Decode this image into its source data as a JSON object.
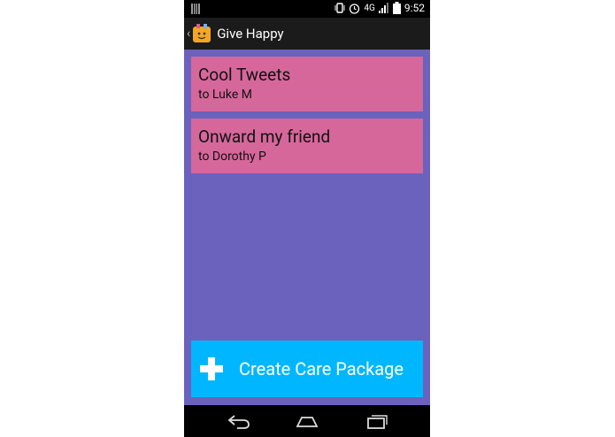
{
  "status_bar": {
    "network": "4G",
    "battery": "",
    "time": "9:52"
  },
  "action_bar": {
    "title": "Give Happy",
    "back_icon": "chevron-left-icon",
    "logo_icon": "smiley-box-icon"
  },
  "cards": [
    {
      "title": "Cool Tweets",
      "subtitle": "to Luke M"
    },
    {
      "title": "Onward my friend",
      "subtitle": "to Dorothy P"
    }
  ],
  "create_button": {
    "label": "Create Care Package",
    "icon": "plus-icon"
  },
  "nav_bar": {
    "icons": [
      "back-icon",
      "home-icon",
      "recent-apps-icon"
    ]
  },
  "colors": {
    "background": "#6a62bd",
    "card": "#d6679b",
    "create_button": "#00b7ff"
  }
}
